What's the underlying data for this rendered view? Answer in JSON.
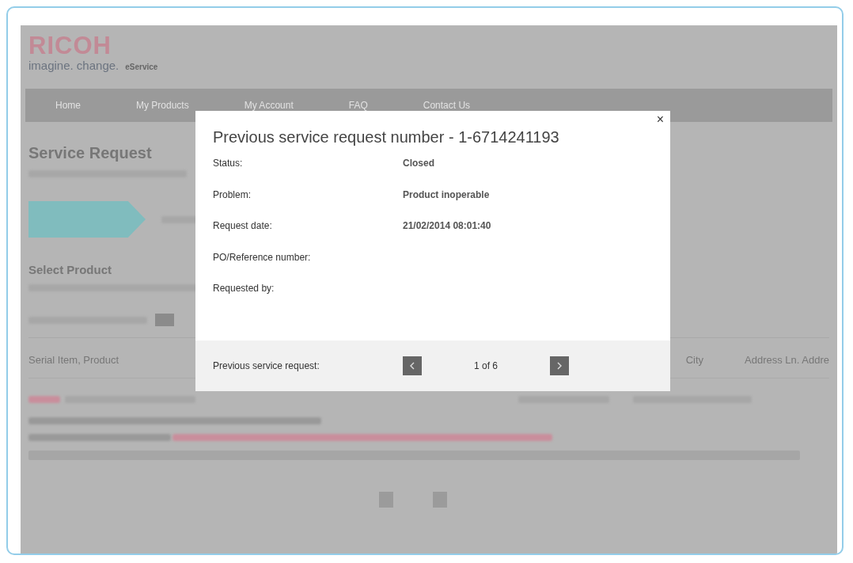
{
  "header": {
    "logo": "RICOH",
    "tagline": "imagine. change.",
    "product": "eService"
  },
  "nav": [
    {
      "label": "Home"
    },
    {
      "label": "My Products"
    },
    {
      "label": "My Account"
    },
    {
      "label": "FAQ"
    },
    {
      "label": "Contact Us"
    }
  ],
  "page": {
    "title": "Service Request",
    "section_title": "Select Product"
  },
  "table": {
    "columns": [
      "Serial Item, Product",
      "City",
      "Address Ln. Addre"
    ]
  },
  "modal": {
    "title": "Previous service request number - 1-6714241193",
    "fields": [
      {
        "label": "Status:",
        "value": "Closed"
      },
      {
        "label": "Problem:",
        "value": "Product inoperable"
      },
      {
        "label": "Request date:",
        "value": "21/02/2014 08:01:40"
      },
      {
        "label": "PO/Reference number:"
      },
      {
        "label": "Requested by:"
      }
    ],
    "close": "×",
    "footer": {
      "label": "Previous service request:",
      "counter": "1 of 6"
    }
  }
}
